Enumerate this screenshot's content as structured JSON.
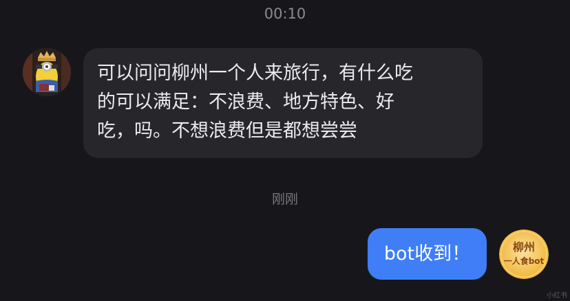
{
  "chat": {
    "timestamp": "00:10",
    "messages": [
      {
        "direction": "incoming",
        "lines": [
          "可以问问柳州一个人来旅行，有什么吃",
          "的可以满足：不浪费、地方特色、好",
          "吃，吗。不想浪费但是都想尝尝"
        ]
      },
      {
        "direction": "outgoing",
        "text": "bot收到！"
      }
    ],
    "divider_time": "刚刚"
  },
  "avatars": {
    "left_icon": "minion-avatar",
    "right_icon": "liuzhou-bot-logo",
    "right_logo_text": "柳州 一人食bot"
  },
  "watermark": "小红书",
  "colors": {
    "background": "#17171b",
    "incoming_bubble": "#26262b",
    "outgoing_bubble": "#3f7ef6",
    "bot_logo": "#f0b93a"
  }
}
